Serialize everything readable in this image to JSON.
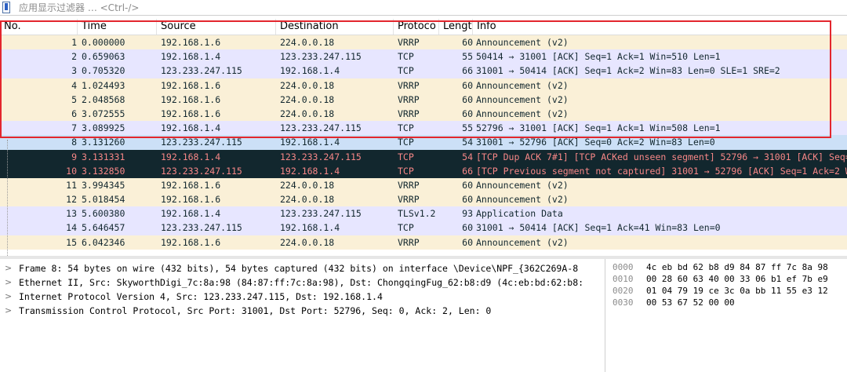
{
  "filter": {
    "placeholder": "应用显示过滤器 … <Ctrl-/>"
  },
  "columns": [
    "No.",
    "Time",
    "Source",
    "Destination",
    "Protoco",
    "Lengt",
    "Info"
  ],
  "packets": [
    {
      "no": "1",
      "time": "0.000000",
      "src": "192.168.1.6",
      "dst": "224.0.0.18",
      "proto": "VRRP",
      "len": "60",
      "info": "Announcement (v2)",
      "bg": "#faf0d7",
      "fg": "#12272e"
    },
    {
      "no": "2",
      "time": "0.659063",
      "src": "192.168.1.4",
      "dst": "123.233.247.115",
      "proto": "TCP",
      "len": "55",
      "info": "50414 → 31001 [ACK] Seq=1 Ack=1 Win=510 Len=1",
      "bg": "#e7e6ff",
      "fg": "#12272e"
    },
    {
      "no": "3",
      "time": "0.705320",
      "src": "123.233.247.115",
      "dst": "192.168.1.4",
      "proto": "TCP",
      "len": "66",
      "info": "31001 → 50414 [ACK] Seq=1 Ack=2 Win=83 Len=0 SLE=1 SRE=2",
      "bg": "#e7e6ff",
      "fg": "#12272e"
    },
    {
      "no": "4",
      "time": "1.024493",
      "src": "192.168.1.6",
      "dst": "224.0.0.18",
      "proto": "VRRP",
      "len": "60",
      "info": "Announcement (v2)",
      "bg": "#faf0d7",
      "fg": "#12272e"
    },
    {
      "no": "5",
      "time": "2.048568",
      "src": "192.168.1.6",
      "dst": "224.0.0.18",
      "proto": "VRRP",
      "len": "60",
      "info": "Announcement (v2)",
      "bg": "#faf0d7",
      "fg": "#12272e"
    },
    {
      "no": "6",
      "time": "3.072555",
      "src": "192.168.1.6",
      "dst": "224.0.0.18",
      "proto": "VRRP",
      "len": "60",
      "info": "Announcement (v2)",
      "bg": "#faf0d7",
      "fg": "#12272e"
    },
    {
      "no": "7",
      "time": "3.089925",
      "src": "192.168.1.4",
      "dst": "123.233.247.115",
      "proto": "TCP",
      "len": "55",
      "info": "52796 → 31001 [ACK] Seq=1 Ack=1 Win=508 Len=1",
      "bg": "#e7e6ff",
      "fg": "#12272e"
    },
    {
      "no": "8",
      "time": "3.131260",
      "src": "123.233.247.115",
      "dst": "192.168.1.4",
      "proto": "TCP",
      "len": "54",
      "info": "31001 → 52796 [ACK] Seq=0 Ack=2 Win=83 Len=0",
      "bg": "#cce0f7",
      "fg": "#12272e"
    },
    {
      "no": "9",
      "time": "3.131331",
      "src": "192.168.1.4",
      "dst": "123.233.247.115",
      "proto": "TCP",
      "len": "54",
      "info": "[TCP Dup ACK 7#1] [TCP ACKed unseen segment] 52796 → 31001 [ACK] Seq=2 Ack=1 Win=508 Len=0",
      "bg": "#12272e",
      "fg": "#f78787"
    },
    {
      "no": "10",
      "time": "3.132850",
      "src": "123.233.247.115",
      "dst": "192.168.1.4",
      "proto": "TCP",
      "len": "66",
      "info": "[TCP Previous segment not captured] 31001 → 52796 [ACK] Seq=1 Ack=2 Win=83 Len=0",
      "bg": "#12272e",
      "fg": "#f78787"
    },
    {
      "no": "11",
      "time": "3.994345",
      "src": "192.168.1.6",
      "dst": "224.0.0.18",
      "proto": "VRRP",
      "len": "60",
      "info": "Announcement (v2)",
      "bg": "#faf0d7",
      "fg": "#12272e"
    },
    {
      "no": "12",
      "time": "5.018454",
      "src": "192.168.1.6",
      "dst": "224.0.0.18",
      "proto": "VRRP",
      "len": "60",
      "info": "Announcement (v2)",
      "bg": "#faf0d7",
      "fg": "#12272e"
    },
    {
      "no": "13",
      "time": "5.600380",
      "src": "192.168.1.4",
      "dst": "123.233.247.115",
      "proto": "TLSv1.2",
      "len": "93",
      "info": "Application Data",
      "bg": "#e7e6ff",
      "fg": "#12272e"
    },
    {
      "no": "14",
      "time": "5.646457",
      "src": "123.233.247.115",
      "dst": "192.168.1.4",
      "proto": "TCP",
      "len": "60",
      "info": "31001 → 50414 [ACK] Seq=1 Ack=41 Win=83 Len=0",
      "bg": "#e7e6ff",
      "fg": "#12272e"
    },
    {
      "no": "15",
      "time": "6.042346",
      "src": "192.168.1.6",
      "dst": "224.0.0.18",
      "proto": "VRRP",
      "len": "60",
      "info": "Announcement (v2)",
      "bg": "#faf0d7",
      "fg": "#12272e"
    }
  ],
  "details": [
    "Frame 8: 54 bytes on wire (432 bits), 54 bytes captured (432 bits) on interface \\Device\\NPF_{362C269A-8",
    "Ethernet II, Src: SkyworthDigi_7c:8a:98 (84:87:ff:7c:8a:98), Dst: ChongqingFug_62:b8:d9 (4c:eb:bd:62:b8:",
    "Internet Protocol Version 4, Src: 123.233.247.115, Dst: 192.168.1.4",
    "Transmission Control Protocol, Src Port: 31001, Dst Port: 52796, Seq: 0, Ack: 2, Len: 0"
  ],
  "hex": [
    {
      "offset": "0000",
      "bytes": "4c eb bd 62 b8 d9 84 87  ff 7c 8a 98"
    },
    {
      "offset": "0010",
      "bytes": "00 28 60 63 40 00 33 06  b1 ef 7b e9"
    },
    {
      "offset": "0020",
      "bytes": "01 04 79 19 ce 3c 0a bb  11 55 e3 12"
    },
    {
      "offset": "0030",
      "bytes": "00 53 67 52 00 00"
    }
  ],
  "colors": {
    "highlight_border": "#e3262e",
    "vrrp_row": "#faf0d7",
    "tcp_row": "#e7e6ff",
    "selected_row": "#cce0f7",
    "bad_tcp_row": "#12272e",
    "bad_tcp_text": "#f78787"
  }
}
